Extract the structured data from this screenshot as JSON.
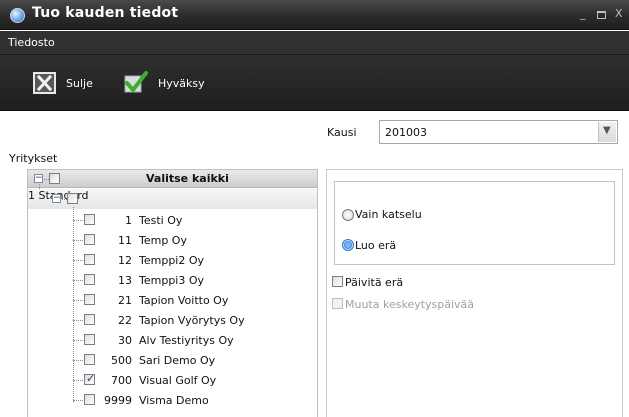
{
  "window": {
    "title": "Tuo kauden tiedot",
    "min_glyph": "_",
    "close_glyph": "X"
  },
  "menu": {
    "file": "Tiedosto"
  },
  "toolbar": {
    "close_label": "Sulje",
    "approve_label": "Hyväksy"
  },
  "period": {
    "label": "Kausi",
    "value": "201003"
  },
  "companies": {
    "label": "Yritykset",
    "select_all": "Valitse kaikki",
    "group": {
      "number": "1",
      "name": "Standard"
    },
    "items": [
      {
        "number": "1",
        "name": "Testi Oy",
        "checked": false
      },
      {
        "number": "11",
        "name": "Temp Oy",
        "checked": false
      },
      {
        "number": "12",
        "name": "Temppi2 Oy",
        "checked": false
      },
      {
        "number": "13",
        "name": "Temppi3 Oy",
        "checked": false
      },
      {
        "number": "21",
        "name": "Tapion Voitto Oy",
        "checked": false
      },
      {
        "number": "22",
        "name": "Tapion Vyörytys Oy",
        "checked": false
      },
      {
        "number": "30",
        "name": "Alv Testiyritys Oy",
        "checked": false
      },
      {
        "number": "500",
        "name": "Sari Demo Oy",
        "checked": false
      },
      {
        "number": "700",
        "name": "Visual Golf Oy",
        "checked": true
      },
      {
        "number": "9999",
        "name": "Visma Demo",
        "checked": false
      }
    ]
  },
  "options": {
    "view_only": "Vain katselu",
    "create_batch": "Luo erä",
    "selected_mode": "create_batch",
    "update_batch": "Päivitä erä",
    "change_suspension_day": "Muuta keskeytyspäivää"
  },
  "colors": {
    "radio_selected": "#3d8ee6",
    "check_mark": "#1f3f99",
    "title_bar": "#2b2b2b"
  }
}
